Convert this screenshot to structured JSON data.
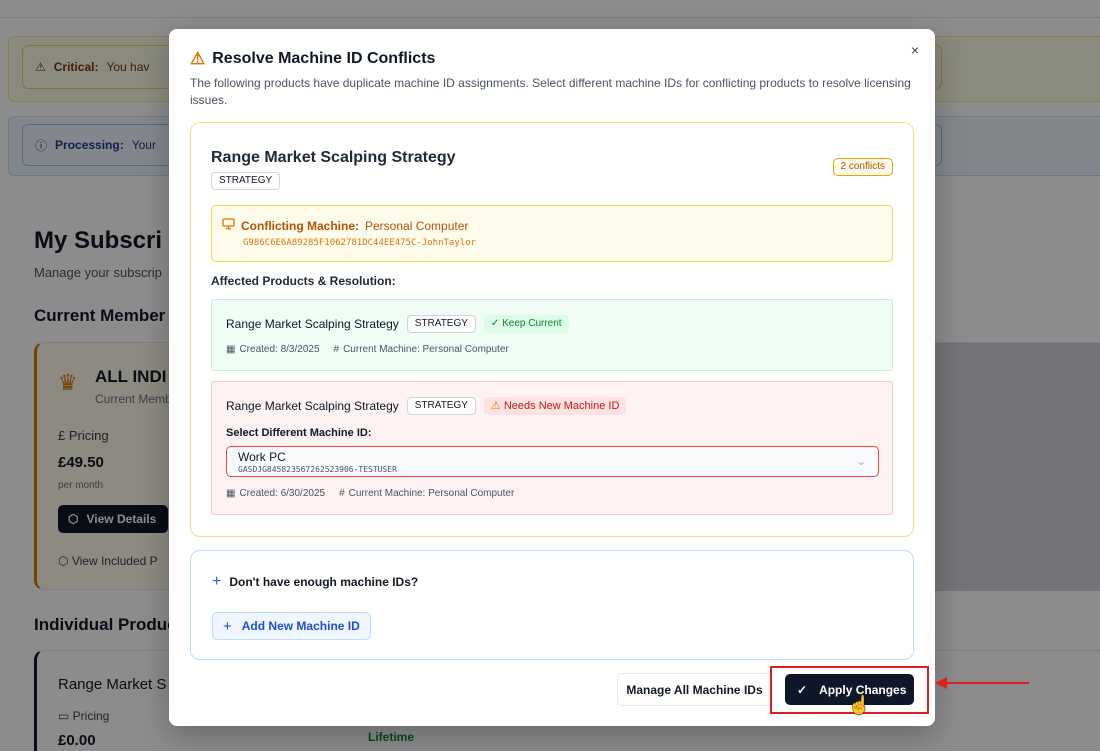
{
  "background": {
    "critical_label": "Critical:",
    "critical_text": "You hav",
    "processing_label": "Processing:",
    "processing_text": "Your",
    "page_title": "My Subscri",
    "page_subtitle": "Manage your subscrip",
    "current_membership_heading": "Current Member",
    "membership_name": "ALL INDI",
    "membership_sub": "Current Memb",
    "pricing_label": "Pricing",
    "price": "£49.50",
    "price_period": "per month",
    "view_details": "View Details",
    "view_included": "View Included P",
    "individual_heading": "Individual Produc",
    "individual_product": "Range Market S",
    "individual_pricing": "Pricing",
    "individual_price": "£0.00",
    "individual_term": "Lifetime"
  },
  "modal": {
    "title": "Resolve Machine ID Conflicts",
    "description": "The following products have duplicate machine ID assignments. Select different machine IDs for conflicting products to resolve licensing issues.",
    "close_symbol": "×",
    "conflict": {
      "product_name": "Range Market Scalping Strategy",
      "product_type": "STRATEGY",
      "conflict_count": "2 conflicts",
      "machine_label": "Conflicting Machine:",
      "machine_name": "Personal Computer",
      "machine_id": "G986C6E6A89285F1062781DC44EE475C-JohnTaylor",
      "affected_heading": "Affected Products & Resolution:",
      "products": [
        {
          "name": "Range Market Scalping Strategy",
          "type": "STRATEGY",
          "status": "Keep Current",
          "created": "Created: 8/3/2025",
          "current_machine": "Current Machine: Personal Computer"
        },
        {
          "name": "Range Market Scalping Strategy",
          "type": "STRATEGY",
          "status": "Needs New Machine ID",
          "select_label": "Select Different Machine ID:",
          "selected_name": "Work PC",
          "selected_id": "GASDJG845823567262523906-TESTUSER",
          "created": "Created: 6/30/2025",
          "current_machine": "Current Machine: Personal Computer"
        }
      ]
    },
    "more_ids": {
      "question": "Don't have enough machine IDs?",
      "add_button": "Add New Machine ID"
    },
    "footer": {
      "manage_button": "Manage All Machine IDs",
      "apply_button": "Apply Changes"
    }
  },
  "colors": {
    "accent_dark": "#0f172a",
    "warning": "#d97706",
    "success": "#15803d",
    "danger": "#b91c1c",
    "annotation_red": "#e11d1d"
  },
  "icons": [
    "warning-triangle-icon",
    "close-icon",
    "monitor-icon",
    "check-icon",
    "calendar-icon",
    "hash-icon",
    "chevron-down-icon",
    "plus-icon",
    "pointer-cursor-icon"
  ]
}
